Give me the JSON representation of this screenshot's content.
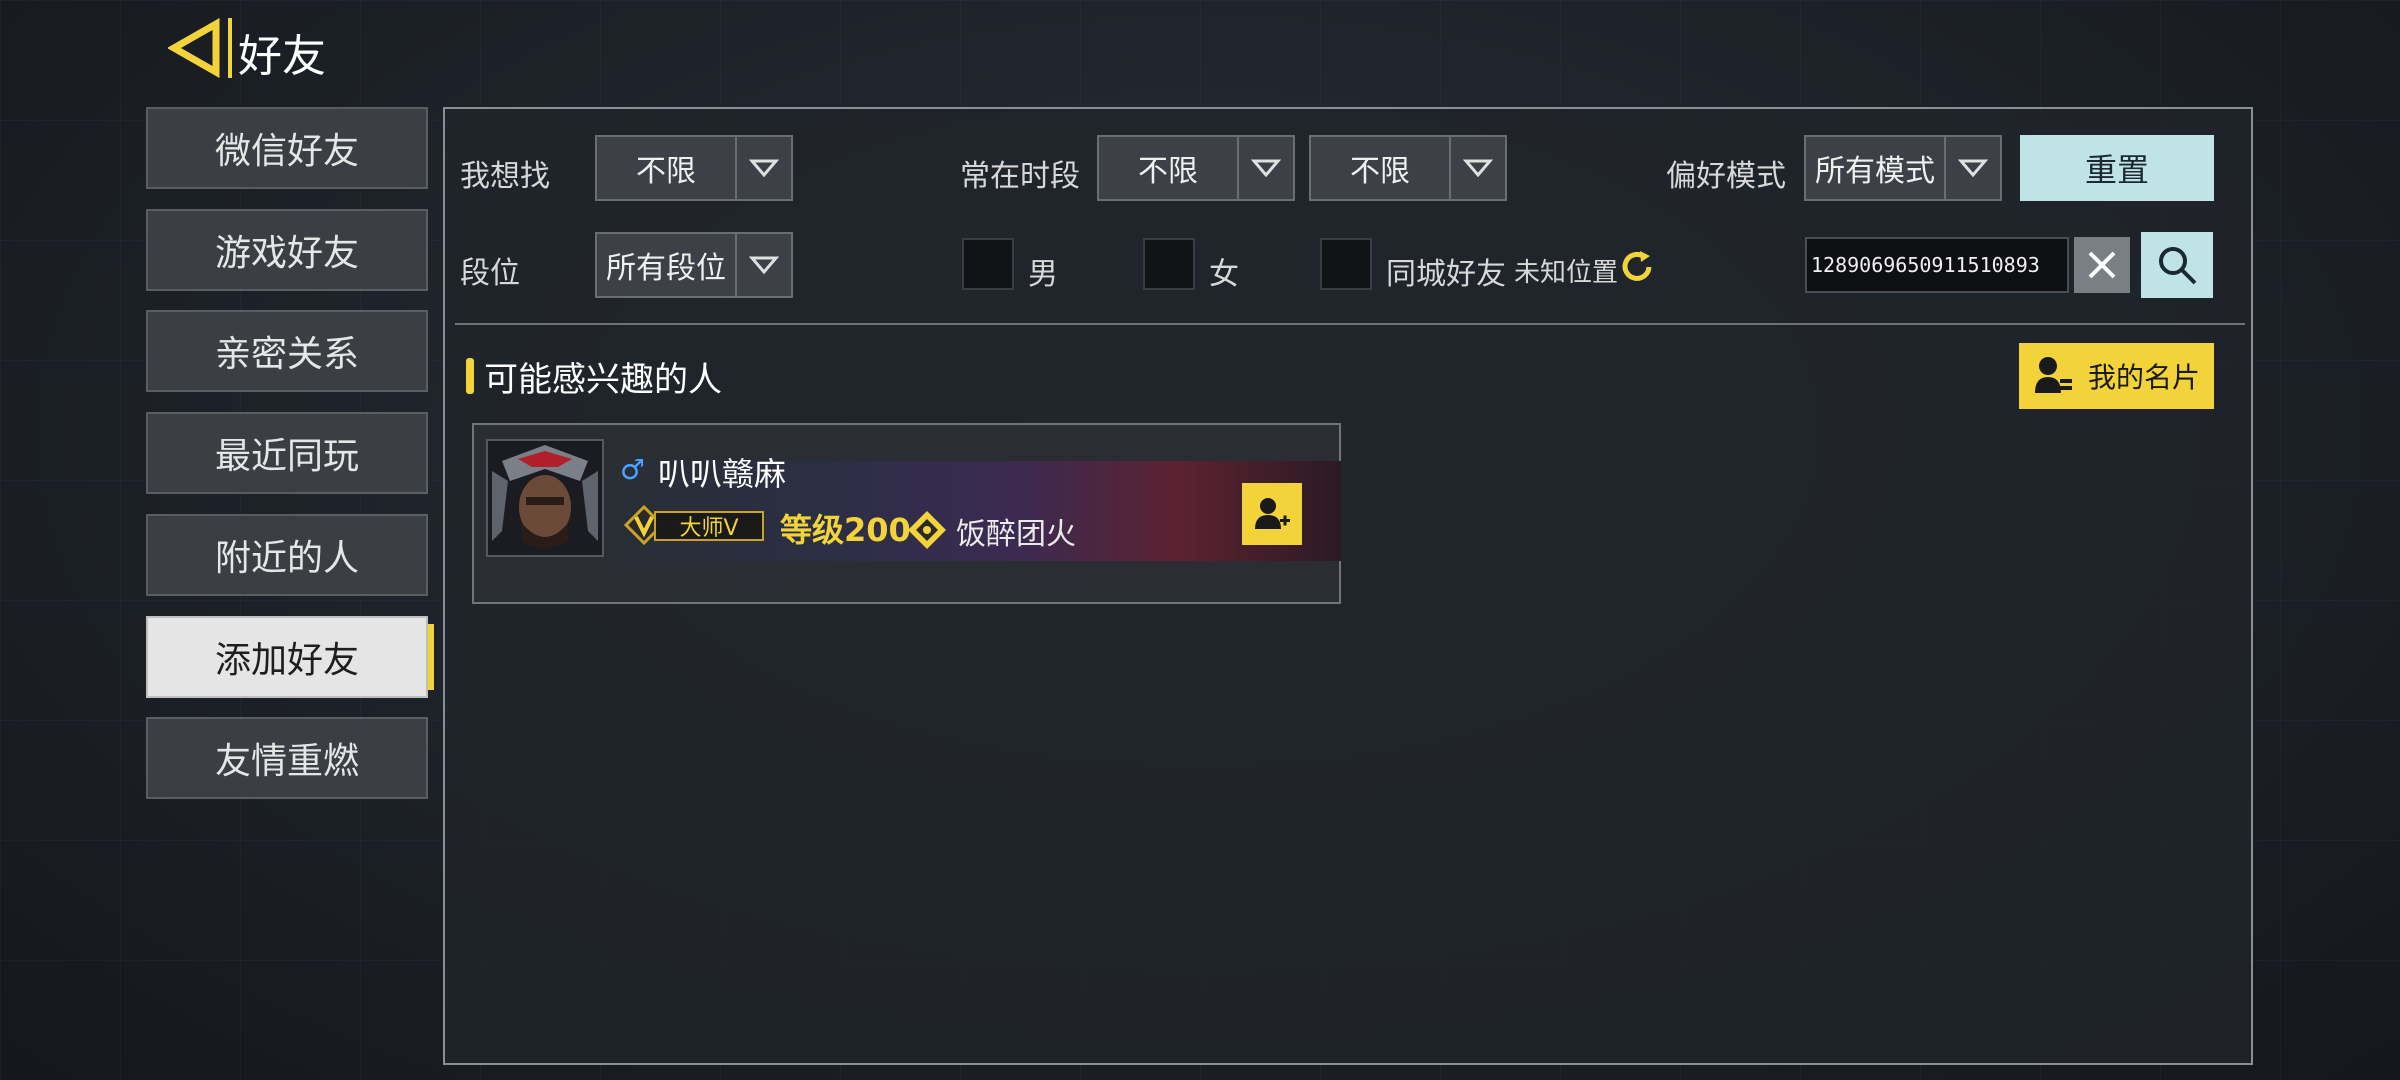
{
  "header": {
    "title": "好友"
  },
  "sidebar": {
    "items": [
      {
        "label": "微信好友"
      },
      {
        "label": "游戏好友"
      },
      {
        "label": "亲密关系"
      },
      {
        "label": "最近同玩"
      },
      {
        "label": "附近的人"
      },
      {
        "label": "添加好友",
        "active": true
      },
      {
        "label": "友情重燃"
      }
    ]
  },
  "filters": {
    "seek_label": "我想找",
    "seek_value": "不限",
    "online_label": "常在时段",
    "online_value_1": "不限",
    "online_value_2": "不限",
    "mode_label": "偏好模式",
    "mode_value": "所有模式",
    "reset_label": "重置",
    "rank_label": "段位",
    "rank_value": "所有段位",
    "male_label": "男",
    "female_label": "女",
    "samecity_label": "同城好友",
    "location_text": "未知位置",
    "search_value": "1289069650911510893"
  },
  "section": {
    "title": "可能感兴趣的人",
    "my_card_label": "我的名片"
  },
  "player": {
    "gender": "♂",
    "name": "叭叭赣麻",
    "rank": "大师Ⅴ",
    "level": "等级200",
    "clan": "饭醉团火"
  },
  "colors": {
    "accent": "#f2d43a",
    "reset_bg": "#bfe3e6",
    "gender_male": "#4aa3ff"
  }
}
